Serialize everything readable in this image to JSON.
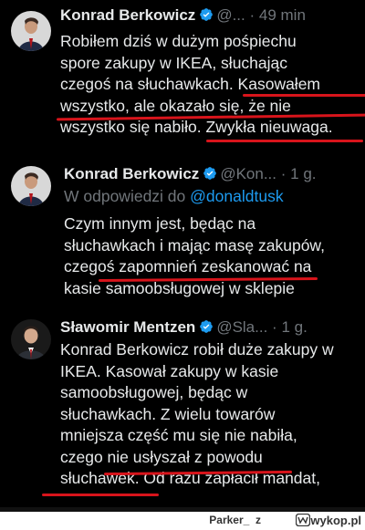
{
  "tweets": [
    {
      "name": "Konrad Berkowicz",
      "handle": "@...",
      "sep": "·",
      "time": "49 min",
      "lines": [
        "Robiłem dziś w dużym pośpiechu",
        "spore zakupy w IKEA, słuchając",
        "czegoś na słuchawkach. Kasowałem",
        "wszystko, ale okazało się, że nie",
        "wszystko się nabiło. Zwykła nieuwaga."
      ]
    },
    {
      "name": "Konrad Berkowicz",
      "handle": "@Kon...",
      "sep": "·",
      "time": "1 g.",
      "reply_prefix": "W odpowiedzi do",
      "reply_mention": "@donaldtusk",
      "lines": [
        "Czym innym jest, będąc na",
        "słuchawkach i mając masę zakupów,",
        "czegoś zapomnień zeskanować na",
        "kasie samoobsługowej w sklepie"
      ]
    },
    {
      "name": "Sławomir Mentzen",
      "handle": "@Sla...",
      "sep": "·",
      "time": "1 g.",
      "lines": [
        "Konrad Berkowicz robił duże zakupy w",
        "IKEA. Kasował zakupy w kasie",
        "samoobsługowej, będąc w",
        "słuchawkach. Z wielu towarów",
        "mniejsza część mu się nie nabiła,",
        "czego nie usłyszał z powodu",
        "słuchawek. Od razu zapłacił mandat,"
      ]
    }
  ],
  "footer": {
    "user": "Parker_",
    "separator": "z",
    "site": "wykop.pl"
  },
  "colors": {
    "background": "#000000",
    "text": "#e7e9ea",
    "muted": "#71767b",
    "verified": "#1d9bf0",
    "mention": "#1d9bf0",
    "underline": "#d8141b"
  },
  "icons": [
    "verified-badge-icon",
    "avatar-icon",
    "wykop-logo-icon"
  ]
}
